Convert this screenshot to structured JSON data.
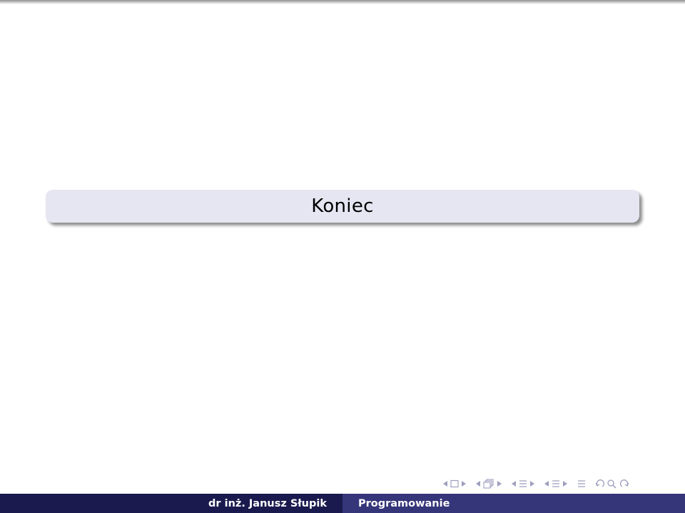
{
  "slide": {
    "title": "Koniec"
  },
  "footer": {
    "author": "dr inż. Janusz Słupik",
    "course": "Programowanie"
  },
  "colors": {
    "title_block_bg": "#e6e6f2",
    "footer_left_bg": "#1a1a4f",
    "footer_right_bg": "#35357a",
    "nav_icon": "#9e9ebe"
  },
  "navigation": {
    "icons": [
      "arrow-left-icon",
      "frame-icon",
      "arrow-right-icon",
      "arrow-left-icon",
      "subsection-icon",
      "arrow-right-icon",
      "arrow-left-icon",
      "section-icon",
      "arrow-right-icon",
      "arrow-left-icon",
      "slide-list-icon",
      "arrow-right-icon",
      "appendix-icon",
      "back-icon",
      "search-icon",
      "forward-icon"
    ]
  }
}
